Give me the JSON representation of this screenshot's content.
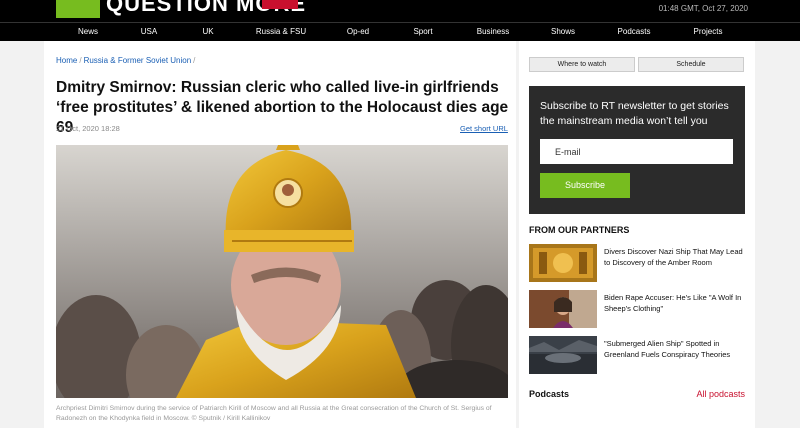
{
  "header": {
    "logo_text": "QUESTION MORE",
    "datetime": "01:48 GMT, Oct 27, 2020"
  },
  "nav": {
    "items": [
      "News",
      "USA",
      "UK",
      "Russia & FSU",
      "Op-ed",
      "Sport",
      "Business",
      "Shows",
      "Podcasts",
      "Projects"
    ]
  },
  "breadcrumb": {
    "home": "Home",
    "section": "Russia & Former Soviet Union"
  },
  "article": {
    "headline": "Dmitry Smirnov: Russian cleric who called live-in girlfriends ‘free prostitutes’ & likened abortion to the Holocaust dies age 69",
    "date": "21 Oct, 2020 18:28",
    "short_url_label": "Get short URL",
    "caption": "Archpriest Dimitri Smirnov during the service of Patriarch Kirill of Moscow and all Russia at the Great consecration of the Church of St. Sergius of Radonezh on the Khodynka field in Moscow. © Sputnik / Kirill Kallinikov"
  },
  "sidebar": {
    "where_to_watch": "Where to watch",
    "schedule": "Schedule",
    "newsletter": {
      "text": "Subscribe to RT newsletter to get stories the mainstream media won’t tell you",
      "email_placeholder": "E-mail",
      "subscribe_label": "Subscribe"
    },
    "partners_title": "FROM OUR PARTNERS",
    "partners": [
      {
        "title": "Divers Discover Nazi Ship That May Lead to Discovery of the Amber Room"
      },
      {
        "title": "Biden Rape Accuser: He's Like \"A Wolf In Sheep's Clothing\""
      },
      {
        "title": "\"Submerged Alien Ship\" Spotted in Greenland Fuels Conspiracy Theories"
      }
    ],
    "podcasts_title": "Podcasts",
    "all_podcasts": "All podcasts"
  },
  "colors": {
    "brand_green": "#77bc1f",
    "accent_red": "#c8102e",
    "link_blue": "#1a5fb4"
  }
}
